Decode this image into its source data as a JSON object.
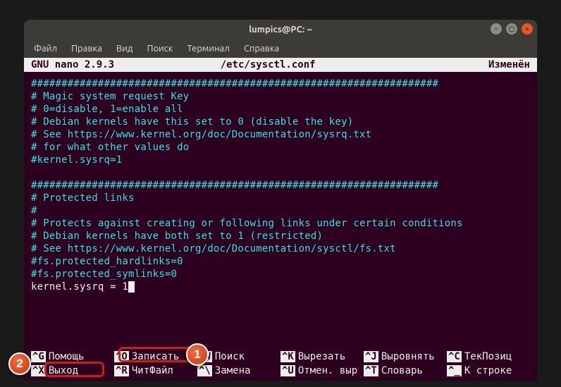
{
  "titlebar": {
    "title": "lumpics@PC: ~"
  },
  "menubar": {
    "items": [
      "Файл",
      "Правка",
      "Вид",
      "Поиск",
      "Терминал",
      "Справка"
    ]
  },
  "nano_header": {
    "left": "GNU nano 2.9.3",
    "center": "/etc/sysctl.conf",
    "right": "Изменён"
  },
  "lines": [
    {
      "class": "comment",
      "text": "###################################################################"
    },
    {
      "class": "comment",
      "text": "# Magic system request Key"
    },
    {
      "class": "comment",
      "text": "# 0=disable, 1=enable all"
    },
    {
      "class": "comment",
      "text": "# Debian kernels have this set to 0 (disable the key)"
    },
    {
      "class": "comment",
      "text": "# See https://www.kernel.org/doc/Documentation/sysrq.txt"
    },
    {
      "class": "comment",
      "text": "# for what other values do"
    },
    {
      "class": "comment",
      "text": "#kernel.sysrq=1"
    },
    {
      "class": "blank",
      "text": ""
    },
    {
      "class": "comment",
      "text": "###################################################################"
    },
    {
      "class": "comment",
      "text": "# Protected links"
    },
    {
      "class": "comment",
      "text": "#"
    },
    {
      "class": "comment",
      "text": "# Protects against creating or following links under certain conditions"
    },
    {
      "class": "comment",
      "text": "# Debian kernels have both set to 1 (restricted)"
    },
    {
      "class": "comment",
      "text": "# See https://www.kernel.org/doc/Documentation/sysctl/fs.txt"
    },
    {
      "class": "comment",
      "text": "#fs.protected_hardlinks=0"
    },
    {
      "class": "comment",
      "text": "#fs.protected_symlinks=0"
    },
    {
      "class": "plain",
      "text": "kernel.sysrq = 1",
      "cursor": true
    }
  ],
  "help": {
    "row1": [
      {
        "key": "^G",
        "label": "Помощь"
      },
      {
        "key": "^O",
        "label": "Записать"
      },
      {
        "key": "^W",
        "label": "Поиск"
      },
      {
        "key": "^K",
        "label": "Вырезать"
      },
      {
        "key": "^J",
        "label": "Выровнять"
      },
      {
        "key": "^C",
        "label": "ТекПозиц"
      }
    ],
    "row2": [
      {
        "key": "^X",
        "label": "Выход"
      },
      {
        "key": "^R",
        "label": "ЧитФайл"
      },
      {
        "key": "^\\",
        "label": "Замена"
      },
      {
        "key": "^U",
        "label": "Отмен. выр"
      },
      {
        "key": "^T",
        "label": "Словарь"
      },
      {
        "key": "^_",
        "label": "К строке"
      }
    ]
  },
  "badges": {
    "b1": "1",
    "b2": "2"
  }
}
